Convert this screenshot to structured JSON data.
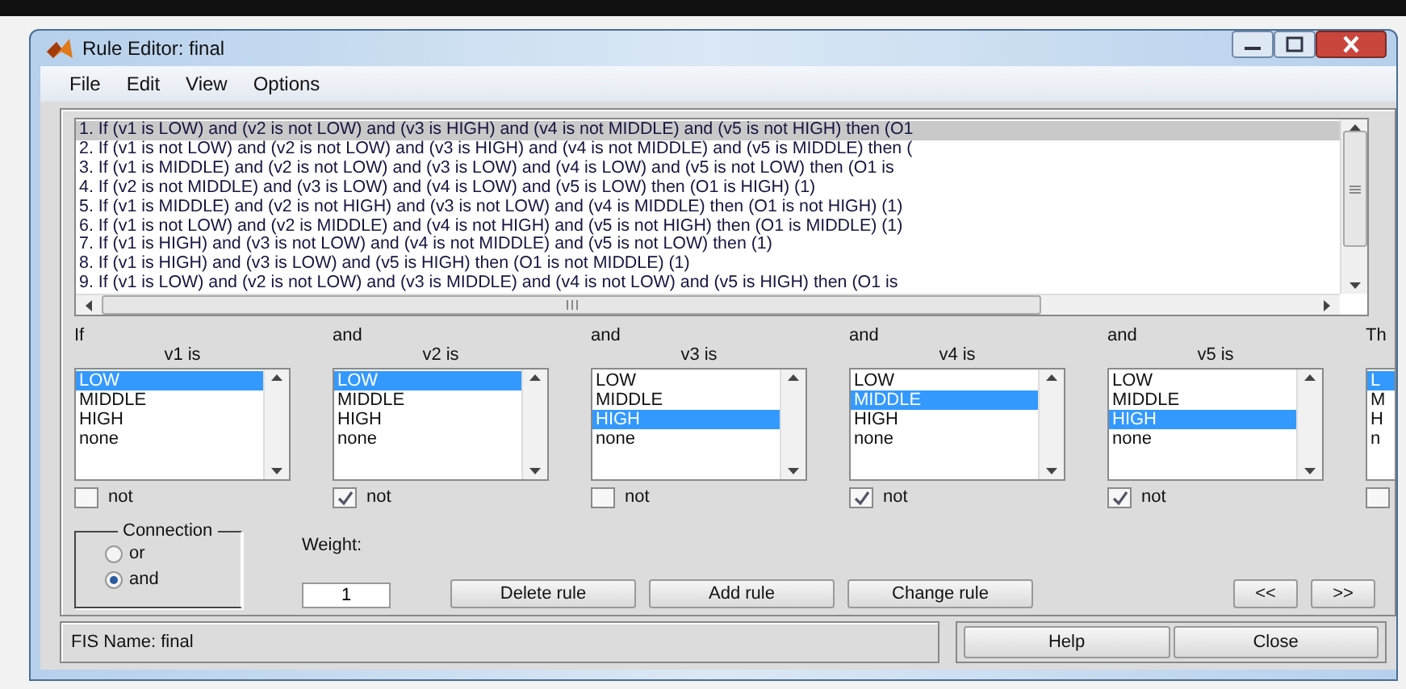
{
  "window": {
    "title": "Rule Editor: final"
  },
  "menu": [
    "File",
    "Edit",
    "View",
    "Options"
  ],
  "rules": [
    {
      "text": "1. If (v1 is LOW) and (v2 is not LOW) and (v3 is HIGH) and (v4 is not MIDDLE) and (v5 is not HIGH) then (O1",
      "selected": true
    },
    {
      "text": "2. If (v1 is not LOW) and (v2 is not LOW) and (v3 is HIGH) and (v4 is not MIDDLE) and (v5 is MIDDLE) then  (",
      "selected": false
    },
    {
      "text": "3. If (v1 is MIDDLE) and (v2 is not LOW) and (v3 is LOW) and (v4 is LOW) and (v5 is not LOW) then (O1 is",
      "selected": false
    },
    {
      "text": "4. If (v2 is not MIDDLE) and (v3 is LOW) and (v4 is LOW) and (v5 is LOW) then (O1 is HIGH) (1)",
      "selected": false
    },
    {
      "text": "5. If (v1 is MIDDLE) and (v2 is not HIGH) and (v3 is not LOW) and (v4 is MIDDLE) then (O1 is not HIGH) (1)",
      "selected": false
    },
    {
      "text": "6. If (v1 is not LOW) and (v2 is MIDDLE) and (v4 is not HIGH) and (v5 is not HIGH) then (O1 is MIDDLE) (1)",
      "selected": false
    },
    {
      "text": "7. If (v1 is HIGH) and (v3 is not LOW) and (v4 is not MIDDLE) and (v5 is not LOW) then  (1)",
      "selected": false
    },
    {
      "text": "8. If (v1 is HIGH) and (v3 is LOW) and (v5 is HIGH) then (O1 is not MIDDLE) (1)",
      "selected": false
    },
    {
      "text": "9. If (v1 is LOW) and (v2 is not LOW) and (v3 is MIDDLE) and (v4 is not LOW) and (v5 is HIGH) then (O1 is",
      "selected": false
    }
  ],
  "inputs": [
    {
      "connector": "If",
      "label": "v1 is",
      "options": [
        {
          "label": "LOW",
          "selected": true
        },
        {
          "label": "MIDDLE",
          "selected": false
        },
        {
          "label": "HIGH",
          "selected": false
        },
        {
          "label": "none",
          "selected": false
        }
      ],
      "not": {
        "label": "not",
        "checked": false
      }
    },
    {
      "connector": "and",
      "label": "v2 is",
      "options": [
        {
          "label": "LOW",
          "selected": true
        },
        {
          "label": "MIDDLE",
          "selected": false
        },
        {
          "label": "HIGH",
          "selected": false
        },
        {
          "label": "none",
          "selected": false
        }
      ],
      "not": {
        "label": "not",
        "checked": true
      }
    },
    {
      "connector": "and",
      "label": "v3 is",
      "options": [
        {
          "label": "LOW",
          "selected": false
        },
        {
          "label": "MIDDLE",
          "selected": false
        },
        {
          "label": "HIGH",
          "selected": true
        },
        {
          "label": "none",
          "selected": false
        }
      ],
      "not": {
        "label": "not",
        "checked": false
      }
    },
    {
      "connector": "and",
      "label": "v4 is",
      "options": [
        {
          "label": "LOW",
          "selected": false
        },
        {
          "label": "MIDDLE",
          "selected": true
        },
        {
          "label": "HIGH",
          "selected": false
        },
        {
          "label": "none",
          "selected": false
        }
      ],
      "not": {
        "label": "not",
        "checked": true
      }
    },
    {
      "connector": "and",
      "label": "v5 is",
      "options": [
        {
          "label": "LOW",
          "selected": false
        },
        {
          "label": "MIDDLE",
          "selected": false
        },
        {
          "label": "HIGH",
          "selected": true
        },
        {
          "label": "none",
          "selected": false
        }
      ],
      "not": {
        "label": "not",
        "checked": true
      }
    },
    {
      "connector": "Th",
      "options": [
        {
          "label": "L",
          "selected": true
        },
        {
          "label": "M",
          "selected": false
        },
        {
          "label": "H",
          "selected": false
        },
        {
          "label": "n",
          "selected": false
        }
      ],
      "not": {
        "checked": false
      }
    }
  ],
  "connection": {
    "label": "Connection",
    "options": [
      {
        "label": "or",
        "selected": false
      },
      {
        "label": "and",
        "selected": true
      }
    ]
  },
  "weight": {
    "label": "Weight:",
    "value": "1"
  },
  "buttons": [
    "Delete rule",
    "Add rule",
    "Change rule"
  ],
  "nav_buttons": [
    "<<",
    ">>"
  ],
  "status": "FIS Name: final",
  "footer_buttons": [
    "Help",
    "Close"
  ]
}
